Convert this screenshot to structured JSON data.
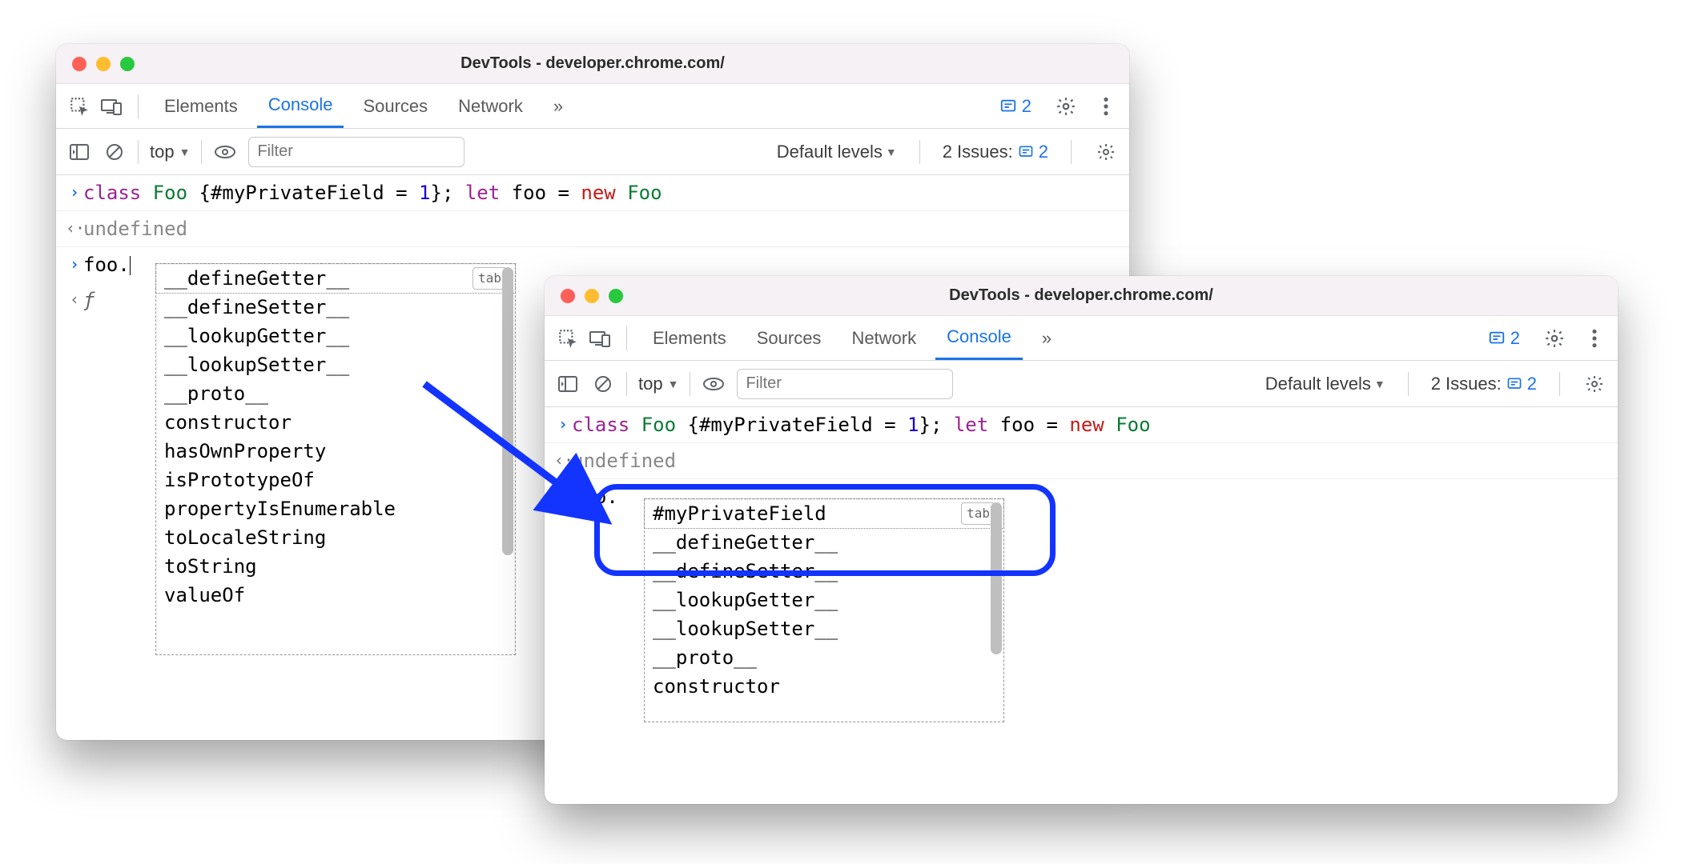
{
  "windows": [
    {
      "title": "DevTools - developer.chrome.com/",
      "tabs": [
        "Elements",
        "Console",
        "Sources",
        "Network"
      ],
      "activeTab": "Console",
      "moreGlyph": "»",
      "issuesBadge": "2",
      "toolbar": {
        "context": "top",
        "filterPlaceholder": "Filter",
        "levels": "Default levels",
        "issuesLabel": "2 Issues:",
        "issuesCount": "2"
      },
      "console": {
        "inputLine": "class Foo {#myPrivateField = 1}; let foo = new Foo",
        "resultLine": "undefined",
        "promptLine": "foo.",
        "echoGlyph": "ƒ",
        "autocomplete": {
          "tabHint": "tab",
          "items": [
            "__defineGetter__",
            "__defineSetter__",
            "__lookupGetter__",
            "__lookupSetter__",
            "__proto__",
            "constructor",
            "hasOwnProperty",
            "isPrototypeOf",
            "propertyIsEnumerable",
            "toLocaleString",
            "toString",
            "valueOf"
          ],
          "selectedIndex": 0
        }
      }
    },
    {
      "title": "DevTools - developer.chrome.com/",
      "tabs": [
        "Elements",
        "Sources",
        "Network",
        "Console"
      ],
      "activeTab": "Console",
      "moreGlyph": "»",
      "issuesBadge": "2",
      "toolbar": {
        "context": "top",
        "filterPlaceholder": "Filter",
        "levels": "Default levels",
        "issuesLabel": "2 Issues:",
        "issuesCount": "2"
      },
      "console": {
        "inputLine": "class Foo {#myPrivateField = 1}; let foo = new Foo",
        "resultLine": "undefined",
        "promptLine": "foo.",
        "autocomplete": {
          "tabHint": "tab",
          "items": [
            "#myPrivateField",
            "__defineGetter__",
            "__defineSetter__",
            "__lookupGetter__",
            "__lookupSetter__",
            "__proto__",
            "constructor"
          ],
          "selectedIndex": 0
        }
      }
    }
  ]
}
